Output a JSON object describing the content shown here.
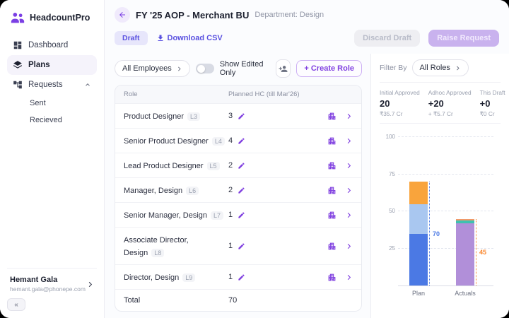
{
  "accent": "#7b3fe4",
  "sidebar": {
    "app_name": "HeadcountPro",
    "items": [
      {
        "label": "Dashboard"
      },
      {
        "label": "Plans"
      },
      {
        "label": "Requests"
      }
    ],
    "sub_items": [
      {
        "label": "Sent"
      },
      {
        "label": "Recieved"
      }
    ],
    "user": {
      "name": "Hemant Gala",
      "email": "hemant.gala@phonepe.com"
    },
    "collapse_label": "«"
  },
  "header": {
    "title": "FY '25 AOP - Merchant BU",
    "department": "Department: Design",
    "status_badge": "Draft",
    "download_csv": "Download CSV",
    "discard_draft": "Discard Draft",
    "raise_request": "Raise Request"
  },
  "filters": {
    "employees_dropdown": "All Employees",
    "show_edited_only": "Show Edited Only",
    "create_role": "+ Create Role",
    "filter_by_label": "Filter By",
    "roles_dropdown": "All Roles"
  },
  "table": {
    "columns": [
      "Role",
      "Planned HC (till Mar'26)"
    ],
    "rows": [
      {
        "role": "Product Designer",
        "level": "L3",
        "hc": "3"
      },
      {
        "role": "Senior Product Designer",
        "level": "L4",
        "hc": "4"
      },
      {
        "role": "Lead Product Designer",
        "level": "L5",
        "hc": "2"
      },
      {
        "role": "Manager, Design",
        "level": "L6",
        "hc": "2"
      },
      {
        "role": "Senior Manager, Design",
        "level": "L7",
        "hc": "1"
      },
      {
        "role": "Associate Director, Design",
        "level": "L8",
        "hc": "1"
      },
      {
        "role": "Director, Design",
        "level": "L9",
        "hc": "1"
      }
    ],
    "total_label": "Total",
    "total_value": "70"
  },
  "stats": [
    {
      "label": "Initial Approved",
      "value": "20",
      "sub": "₹35.7 Cr"
    },
    {
      "label": "Adhoc Approved",
      "value": "+20",
      "sub": "+ ₹5.7 Cr"
    },
    {
      "label": "This Draft",
      "value": "+0",
      "sub": "₹0 Cr"
    }
  ],
  "chart_data": {
    "type": "bar",
    "categories": [
      "Plan",
      "Actuals"
    ],
    "stacks": [
      [
        {
          "value": 35,
          "color": "#4b79e4"
        },
        {
          "value": 20,
          "color": "#a9c7f0"
        },
        {
          "value": 15,
          "color": "#f9a43c"
        }
      ],
      [
        {
          "value": 42,
          "color": "#b18fd9"
        },
        {
          "value": 2,
          "color": "#3fc1b0"
        },
        {
          "value": 1,
          "color": "#f09a6a"
        }
      ]
    ],
    "totals": [
      70,
      45
    ],
    "total_label_colors": [
      "#4b79e4",
      "#f9862c"
    ],
    "ylim": [
      0,
      100
    ],
    "yticks": [
      25,
      50,
      75,
      100
    ],
    "grid": "dashed",
    "title": ""
  }
}
